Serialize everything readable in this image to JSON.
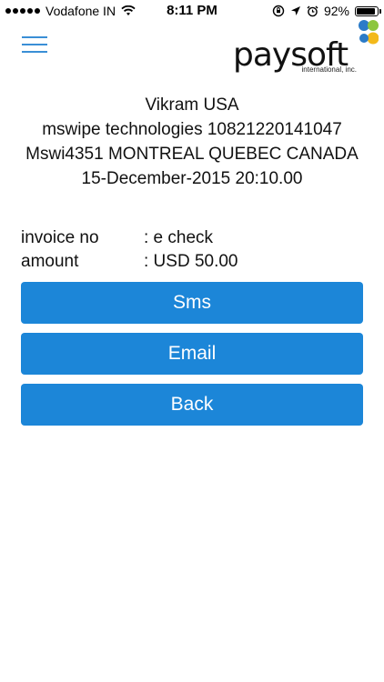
{
  "status_bar": {
    "carrier": "Vodafone IN",
    "time": "8:11 PM",
    "battery_percent": "92%",
    "battery_level": 0.92
  },
  "header": {
    "logo_word": "paysoft",
    "logo_sub": "international, inc.",
    "menu_icon": "hamburger-menu-icon",
    "logo_colors": [
      "#2b7bc8",
      "#8cc63f",
      "#f3b91a",
      "#2b7bc8"
    ]
  },
  "merchant": {
    "name": "Vikram USA",
    "company": "mswipe technologies 10821220141047",
    "location": "Mswi4351 MONTREAL QUEBEC CANADA",
    "datetime": "15-December-2015 20:10.00"
  },
  "details": [
    {
      "label": "invoice no",
      "value": ": e check"
    },
    {
      "label": "amount",
      "value": ": USD 50.00"
    }
  ],
  "buttons": {
    "sms": "Sms",
    "email": "Email",
    "back": "Back"
  },
  "colors": {
    "accent": "#1c86d8",
    "menu": "#3a8fd6"
  }
}
